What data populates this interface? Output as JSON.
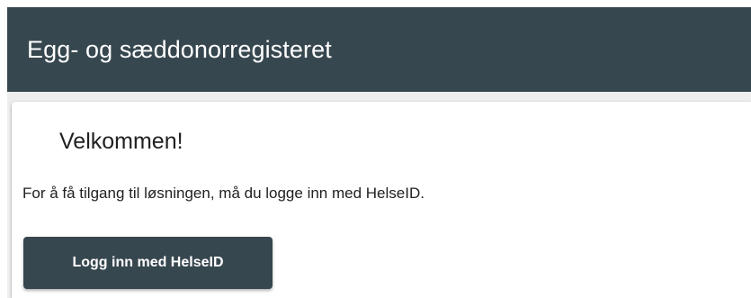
{
  "header": {
    "title": "Egg- og sæddonorregisteret"
  },
  "welcome": {
    "heading": "Velkommen!",
    "description": "For å få tilgang til løsningen, må du logge inn med HelseID.",
    "login_label": "Logg inn med HelseID"
  },
  "colors": {
    "primary": "#37474f",
    "background": "#eeeeee",
    "card": "#ffffff",
    "text": "#212121"
  }
}
